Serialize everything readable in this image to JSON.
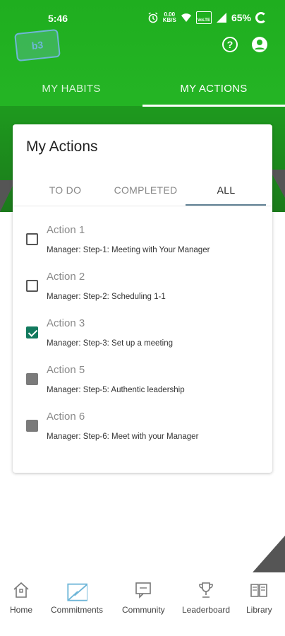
{
  "status_bar": {
    "time": "5:46",
    "net_speed_top": "0.00",
    "net_speed_bottom": "KB/S",
    "signal_label": "VoLTE",
    "battery": "65%"
  },
  "logo": {
    "text": "b3"
  },
  "top_tabs": [
    {
      "label": "MY HABITS",
      "active": false
    },
    {
      "label": "MY ACTIONS",
      "active": true
    }
  ],
  "card": {
    "title": "My Actions",
    "sub_tabs": [
      {
        "label": "TO DO",
        "active": false
      },
      {
        "label": "COMPLETED",
        "active": false
      },
      {
        "label": "ALL",
        "active": true
      }
    ],
    "actions": [
      {
        "title": "Action 1",
        "subtitle": "Manager: Step-1: Meeting with Your Manager",
        "state": "unchecked"
      },
      {
        "title": "Action 2",
        "subtitle": "Manager: Step-2: Scheduling 1-1",
        "state": "unchecked"
      },
      {
        "title": "Action 3",
        "subtitle": "Manager: Step-3: Set up a meeting",
        "state": "checked"
      },
      {
        "title": "Action 5",
        "subtitle": "Manager: Step-5: Authentic leadership",
        "state": "disabled"
      },
      {
        "title": "Action 6",
        "subtitle": "Manager: Step-6: Meet with your Manager",
        "state": "disabled"
      }
    ]
  },
  "bottom_nav": [
    {
      "label": "Home",
      "icon": "home-icon"
    },
    {
      "label": "Commitments",
      "icon": "envelope-icon"
    },
    {
      "label": "Community",
      "icon": "chat-icon"
    },
    {
      "label": "Leaderboard",
      "icon": "trophy-icon"
    },
    {
      "label": "Library",
      "icon": "book-icon"
    }
  ],
  "colors": {
    "brand_green": "#25b525",
    "checkbox_checked": "#127a5e",
    "tab_indicator": "#5f7f93"
  }
}
